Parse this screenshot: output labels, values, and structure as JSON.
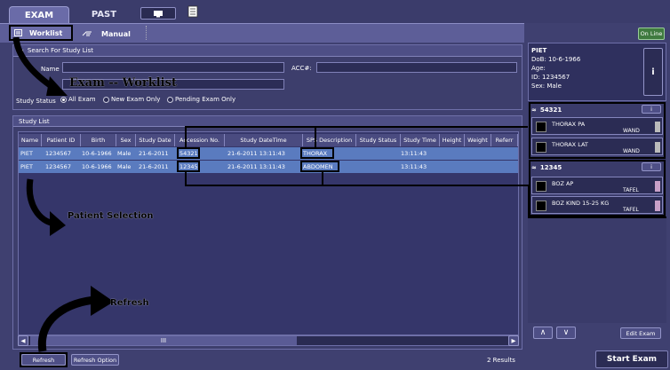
{
  "tabs": {
    "exam": "EXAM",
    "past": "PAST"
  },
  "subtabs": {
    "worklist": "Worklist",
    "manual": "Manual"
  },
  "online": "On Line",
  "search": {
    "header": "Search For Study List",
    "name_label": "Name",
    "acc_label": "ACC#:",
    "status_label": "Study Status",
    "options": [
      "All Exam",
      "New Exam Only",
      "Pending Exam Only"
    ],
    "selected": 0
  },
  "study_list": {
    "header": "Study List",
    "columns": [
      "Name",
      "Patient ID",
      "Birth",
      "Sex",
      "Study Date",
      "Accession No.",
      "Study DateTime",
      "SPS Description",
      "Study Status",
      "Study Time",
      "Height",
      "Weight",
      "Referr"
    ],
    "rows": [
      [
        "PIET",
        "1234567",
        "10-6-1966",
        "Male",
        "21-6-2011",
        "54321",
        "21-6-2011 13:11:43",
        "THORAX",
        "",
        "13:11:43",
        "",
        "",
        ""
      ],
      [
        "PIET",
        "1234567",
        "10-6-1966",
        "Male",
        "21-6-2011",
        "12345",
        "21-6-2011 13:11:43",
        "ABDOMEN",
        "",
        "13:11:43",
        "",
        "",
        ""
      ]
    ],
    "results": "2 Results",
    "scroll_mid": "III"
  },
  "buttons": {
    "refresh": "Refresh",
    "refresh_option": "Refresh Option",
    "edit_exam": "Edit Exam",
    "start_exam": "Start Exam"
  },
  "patient": {
    "name": "PIET",
    "dob": "DoB: 10-6-1966",
    "age": "Age:",
    "id": "ID: 1234567",
    "sex": "Sex: Male",
    "info_icon": "i"
  },
  "studies": [
    {
      "accession": "54321",
      "items": [
        {
          "name": "THORAX PA",
          "sub": "WAND"
        },
        {
          "name": "THORAX LAT",
          "sub": "WAND"
        }
      ]
    },
    {
      "accession": "12345",
      "items": [
        {
          "name": "BOZ AP",
          "sub": "TAFEL"
        },
        {
          "name": "BOZ KIND 15-25 KG",
          "sub": "TAFEL"
        }
      ]
    }
  ],
  "annotations": {
    "exam_worklist": "Exam -- Worklist",
    "patient_selection": "Patient Selection",
    "refresh": "Refresh"
  },
  "colors": {
    "background": "#3f4070",
    "selected_row": "#5a7bbf",
    "panel_header": "#4e4f86"
  }
}
